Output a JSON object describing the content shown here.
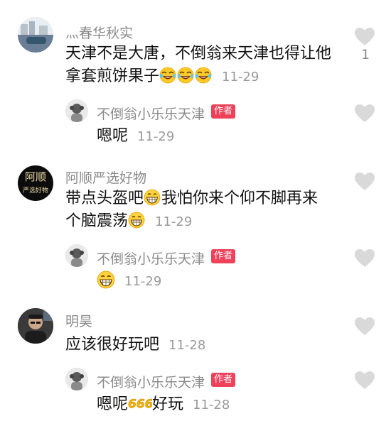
{
  "comments": [
    {
      "username": "灬春华秋实",
      "text_line1": "天津不是大唐，不倒翁来天津也得让他",
      "text_line2": "拿套煎饼果子",
      "emoji": "laughing-tears-emoji",
      "time": "11-29",
      "likes": "1",
      "reply": {
        "username": "不倒翁小乐乐天津",
        "badge": "作者",
        "text": "嗯呢",
        "time": "11-29"
      }
    },
    {
      "username": "阿顺严选好物",
      "avatar_text_line1": "阿顺",
      "avatar_text_line2": "严选好物",
      "text_line1": "带点头盔吧",
      "text_line1_after_emoji": "我怕你来个仰不脚再来",
      "text_line2": "个脑震荡",
      "emoji": "grinning-emoji",
      "time": "11-29",
      "reply": {
        "username": "不倒翁小乐乐天津",
        "badge": "作者",
        "text": "",
        "emoji": "grinning-emoji",
        "time": "11-29"
      }
    },
    {
      "username": "明昊",
      "text": "应该很好玩吧",
      "time": "11-28",
      "reply": {
        "username": "不倒翁小乐乐天津",
        "badge": "作者",
        "text_before_emoji": "嗯呢",
        "emoji": "666-emoji",
        "text_after_emoji": "好玩",
        "time": "11-28"
      }
    }
  ],
  "colors": {
    "username": "#8a8a8a",
    "text": "#111111",
    "time": "#9a9a9a",
    "badge_bg": "#f0415a",
    "heart": "#d9d9d9"
  }
}
